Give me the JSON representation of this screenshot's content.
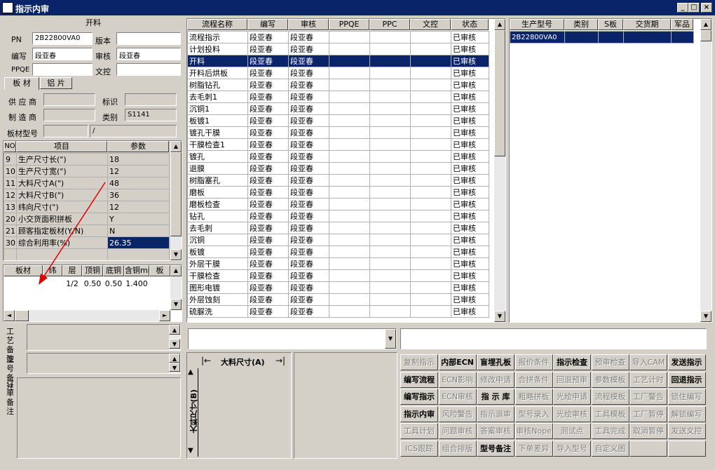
{
  "window": {
    "title": "指示内审",
    "btn_min": "_",
    "btn_max": "□",
    "btn_close": "×"
  },
  "left": {
    "header": "开料",
    "pn_label": "PN",
    "pn_value": "2B22800VA0",
    "version_label": "版本",
    "version_value": "",
    "editor_label": "编写",
    "editor_value": "段亚春",
    "reviewer_label": "审核",
    "reviewer_value": "段亚春",
    "ppqe_label": "PPQE",
    "ppqe_value": "",
    "wenkong_label": "文控",
    "wenkong_value": "",
    "tabs": [
      "板 材",
      "铝 片"
    ],
    "supplier_label": "供 应 商",
    "supplier_value": "",
    "mark_label": "标识",
    "mark_value": "",
    "maker_label": "制 造 商",
    "maker_value": "",
    "category_label": "类别",
    "category_value": "S1141",
    "model_label": "板材型号",
    "model_value": "",
    "model_value2": "/",
    "params_headers": [
      "NO",
      "项目",
      "参数"
    ],
    "params": [
      {
        "no": "9",
        "item": "生产尺寸长(\")",
        "val": "18"
      },
      {
        "no": "10",
        "item": "生产尺寸宽(\")",
        "val": "12"
      },
      {
        "no": "11",
        "item": "大料尺寸A(\")",
        "val": "48"
      },
      {
        "no": "12",
        "item": "大料尺寸B(\")",
        "val": "36"
      },
      {
        "no": "13",
        "item": "纬向尺寸(\")",
        "val": "12"
      },
      {
        "no": "20",
        "item": "小交货面积拼板",
        "val": "Y"
      },
      {
        "no": "21",
        "item": "顾客指定板材(Y/N)",
        "val": "N"
      },
      {
        "no": "30",
        "item": "综合利用率(%)",
        "val": "26.35"
      }
    ],
    "mat_headers": [
      "板材",
      "纬",
      "层",
      "顶铜",
      "底铜",
      "含铜mm",
      "板"
    ],
    "mat_row": [
      "",
      "",
      "1/2",
      "0.50",
      "0.50",
      "1.400",
      ""
    ],
    "gongyi_label": "工艺备注",
    "xinghao_label": "型号备注",
    "dingdan_label": "订单备注"
  },
  "flow": {
    "headers": [
      "流程名称",
      "编写",
      "审核",
      "PPQE",
      "PPC",
      "文控",
      "状态"
    ],
    "rows": [
      [
        "流程指示",
        "段亚春",
        "段亚春",
        "",
        "",
        "",
        "已审核"
      ],
      [
        "计划投料",
        "段亚春",
        "段亚春",
        "",
        "",
        "",
        "已审核"
      ],
      [
        "开料",
        "段亚春",
        "段亚春",
        "",
        "",
        "",
        "已审核"
      ],
      [
        "开料后烘板",
        "段亚春",
        "段亚春",
        "",
        "",
        "",
        "已审核"
      ],
      [
        "树脂钻孔",
        "段亚春",
        "段亚春",
        "",
        "",
        "",
        "已审核"
      ],
      [
        "去毛刺1",
        "段亚春",
        "段亚春",
        "",
        "",
        "",
        "已审核"
      ],
      [
        "沉铜1",
        "段亚春",
        "段亚春",
        "",
        "",
        "",
        "已审核"
      ],
      [
        "板镀1",
        "段亚春",
        "段亚春",
        "",
        "",
        "",
        "已审核"
      ],
      [
        "镀孔干膜",
        "段亚春",
        "段亚春",
        "",
        "",
        "",
        "已审核"
      ],
      [
        "干膜检查1",
        "段亚春",
        "段亚春",
        "",
        "",
        "",
        "已审核"
      ],
      [
        "镀孔",
        "段亚春",
        "段亚春",
        "",
        "",
        "",
        "已审核"
      ],
      [
        "退膜",
        "段亚春",
        "段亚春",
        "",
        "",
        "",
        "已审核"
      ],
      [
        "树脂塞孔",
        "段亚春",
        "段亚春",
        "",
        "",
        "",
        "已审核"
      ],
      [
        "磨板",
        "段亚春",
        "段亚春",
        "",
        "",
        "",
        "已审核"
      ],
      [
        "磨板检查",
        "段亚春",
        "段亚春",
        "",
        "",
        "",
        "已审核"
      ],
      [
        "钻孔",
        "段亚春",
        "段亚春",
        "",
        "",
        "",
        "已审核"
      ],
      [
        "去毛刺",
        "段亚春",
        "段亚春",
        "",
        "",
        "",
        "已审核"
      ],
      [
        "沉铜",
        "段亚春",
        "段亚春",
        "",
        "",
        "",
        "已审核"
      ],
      [
        "板镀",
        "段亚春",
        "段亚春",
        "",
        "",
        "",
        "已审核"
      ],
      [
        "外层干膜",
        "段亚春",
        "段亚春",
        "",
        "",
        "",
        "已审核"
      ],
      [
        "干膜检查",
        "段亚春",
        "段亚春",
        "",
        "",
        "",
        "已审核"
      ],
      [
        "图形电镀",
        "段亚春",
        "段亚春",
        "",
        "",
        "",
        "已审核"
      ],
      [
        "外层蚀刻",
        "段亚春",
        "段亚春",
        "",
        "",
        "",
        "已审核"
      ],
      [
        "硫脲洗",
        "段亚春",
        "段亚春",
        "",
        "",
        "",
        "已审核"
      ]
    ],
    "selected_index": 2
  },
  "prod": {
    "headers": [
      "生产型号",
      "类别",
      "S板",
      "交货期",
      "军品"
    ],
    "rows": [
      [
        "2B22800VA0",
        "",
        "",
        "",
        ""
      ]
    ]
  },
  "diagram": {
    "label_a": "大料尺寸(A)",
    "label_b": "大料尺寸(B)"
  },
  "buttons": [
    [
      {
        "t": "复制指示",
        "s": "dis"
      },
      {
        "t": "内部ECN",
        "s": "en"
      },
      {
        "t": "盲埋孔板",
        "s": "en"
      },
      {
        "t": "报价条件",
        "s": "dis"
      },
      {
        "t": "指示检查",
        "s": "en"
      },
      {
        "t": "预审检查",
        "s": "dis"
      },
      {
        "t": "导入CAM",
        "s": "dis"
      },
      {
        "t": "发送指示",
        "s": "en"
      }
    ],
    [
      {
        "t": "编写流程",
        "s": "en"
      },
      {
        "t": "ECN影响",
        "s": "dis"
      },
      {
        "t": "修改申请",
        "s": "dis"
      },
      {
        "t": "合拼条件",
        "s": "dis"
      },
      {
        "t": "回退预审",
        "s": "dis"
      },
      {
        "t": "参数模板",
        "s": "dis"
      },
      {
        "t": "工艺计时",
        "s": "dis"
      },
      {
        "t": "回退指示",
        "s": "en"
      }
    ],
    [
      {
        "t": "编写指示",
        "s": "en"
      },
      {
        "t": "ECN审核",
        "s": "dis"
      },
      {
        "t": "指 示 库",
        "s": "en"
      },
      {
        "t": "粗略拼板",
        "s": "dis"
      },
      {
        "t": "光绘申请",
        "s": "dis"
      },
      {
        "t": "流程模板",
        "s": "dis"
      },
      {
        "t": "工厂警告",
        "s": "dis"
      },
      {
        "t": "锁住编写",
        "s": "dis"
      }
    ],
    [
      {
        "t": "指示内审",
        "s": "en"
      },
      {
        "t": "风险警告",
        "s": "dis"
      },
      {
        "t": "指示退审",
        "s": "dis"
      },
      {
        "t": "型号录入",
        "s": "dis"
      },
      {
        "t": "光绘审核",
        "s": "dis"
      },
      {
        "t": "工具模板",
        "s": "dis"
      },
      {
        "t": "工厂暂停",
        "s": "dis"
      },
      {
        "t": "解锁编写",
        "s": "dis"
      }
    ],
    [
      {
        "t": "工具计划",
        "s": "dis"
      },
      {
        "t": "问题审核",
        "s": "dis"
      },
      {
        "t": "答案审核",
        "s": "dis"
      },
      {
        "t": "审核Nope",
        "s": "dis"
      },
      {
        "t": "测试点",
        "s": "dis"
      },
      {
        "t": "工具完成",
        "s": "dis"
      },
      {
        "t": "取消暂停",
        "s": "dis"
      },
      {
        "t": "发送文控",
        "s": "dis"
      }
    ],
    [
      {
        "t": "ICS跟踪",
        "s": "dis"
      },
      {
        "t": "组合排版",
        "s": "dis"
      },
      {
        "t": "型号备注",
        "s": "en"
      },
      {
        "t": "下单差异",
        "s": "dis"
      },
      {
        "t": "导入型号",
        "s": "dis"
      },
      {
        "t": "自定义图",
        "s": "dis"
      },
      {
        "t": "",
        "s": "dis"
      },
      {
        "t": "",
        "s": "dis"
      }
    ]
  ],
  "colors": {
    "title_bg": "#0a246a",
    "selection": "#0a246a",
    "annotation": "#e00000"
  }
}
